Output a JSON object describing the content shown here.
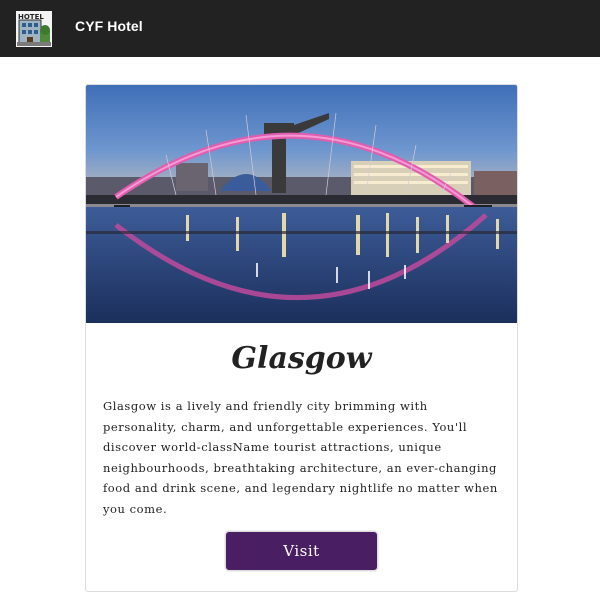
{
  "navbar": {
    "brand": "CYF Hotel",
    "logo_icon": "hotel-building-icon",
    "logo_text": "HOTEL",
    "background": "#222222"
  },
  "card": {
    "image_icon": "glasgow-clyde-arc-bridge-photo",
    "title": "Glasgow",
    "text": "Glasgow is a lively and friendly city brimming with personality, charm, and unforgettable experiences. You'll discover world-className tourist attractions, unique neighbourhoods, breathtaking architecture, an ever-changing food and drink scene, and legendary nightlife no matter when you come.",
    "button_label": "Visit",
    "button_color": "#4a1e63"
  }
}
